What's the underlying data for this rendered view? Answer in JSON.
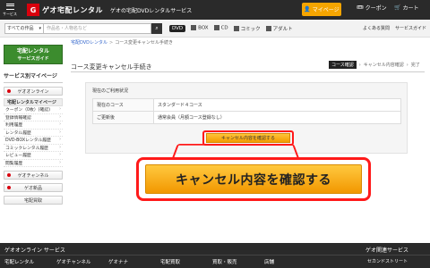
{
  "header": {
    "menu_label": "サービス",
    "logo_badge": "G",
    "logo_text": "ゲオ宅配レンタル",
    "tagline": "ゲオの宅配DVDレンタルサービス",
    "mypage": "マイページ",
    "coupon": "クーポン",
    "cart": "カート"
  },
  "search": {
    "category": "すべての作品",
    "placeholder": "作品名・人物名など",
    "cats": [
      "DVD",
      "BOX",
      "CD",
      "コミック",
      "アダルト"
    ],
    "help": [
      "よくある質問",
      "サービスガイド"
    ]
  },
  "breadcrumb": {
    "home": "宅配DVDレンタル",
    "current": "コース変更キャンセル手続き"
  },
  "sidebar": {
    "banner_line1": "宅配レンタル",
    "banner_line2": "サービスガイド",
    "title": "サービス別マイページ",
    "online_btn": "ゲオオンライン",
    "rental_heading": "宅配レンタルマイページ",
    "links": [
      "クーポン（0枚）(確認)",
      "登録情報確認",
      "利用履歴",
      "レンタル履歴",
      "DVD-BOXレンタル履歴",
      "コミックレンタル履歴",
      "レビュー履歴",
      "閲覧履歴"
    ],
    "geo_channel": "ゲオチャンネル",
    "geo_mobile": "ゲオ新品",
    "takuhai_kaitori": "宅配買取"
  },
  "main": {
    "title": "コース変更キャンセル手続き",
    "steps": [
      "コース確認",
      "キャンセル内容確認",
      "完了"
    ],
    "panel_heading": "現在のご利用状況",
    "rows": [
      {
        "key": "現在のコース",
        "value": "スタンダード４コース"
      },
      {
        "key": "ご更新後",
        "value": "通常会員（月額コース登録なし）"
      }
    ],
    "confirm_small": "キャンセル内容を確認する",
    "confirm_big": "キャンセル内容を確認する"
  },
  "footer": {
    "title": "ゲオオンライン サービス",
    "right_title": "ゲオ関連サービス",
    "links": [
      "宅配レンタル",
      "ゲオチャンネル",
      "ゲオナナ",
      "宅配買取",
      "買取・販売",
      "店舗"
    ],
    "second": "セカンドストリート"
  },
  "colors": {
    "accent": "#f29b00",
    "highlight": "#ff1a1a",
    "header_bg": "#2a2a2a"
  }
}
